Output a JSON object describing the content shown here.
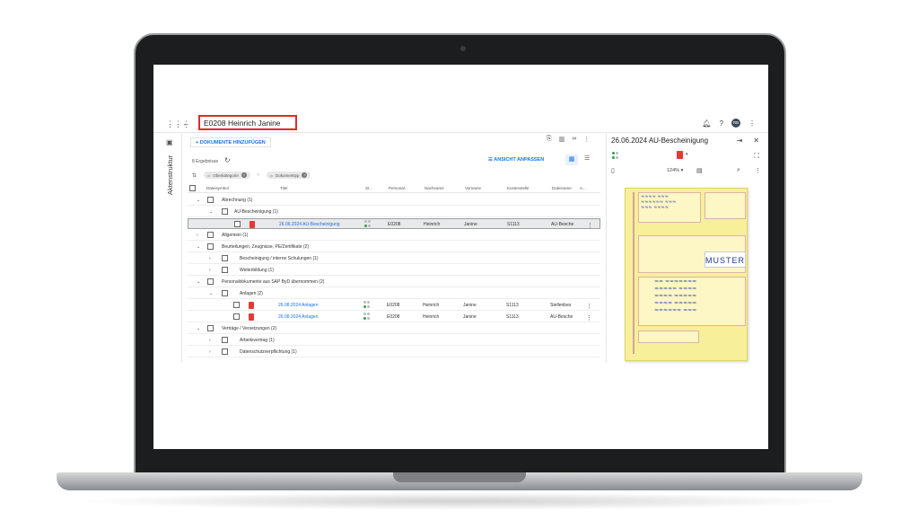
{
  "header": {
    "title": "E0208 Heinrich Janine",
    "avatar_initials": "RB"
  },
  "sidebar": {
    "label": "Aktenstruktur"
  },
  "toolbar": {
    "add_documents": "+ DOKUMENTE HINZUFÜGEN",
    "results": "8 Ergebnisse",
    "adjust_view": "ANSICHT ANPASSEN"
  },
  "filters": [
    {
      "label": "Oberkategorie"
    },
    {
      "label": "Dokumenttyp"
    }
  ],
  "table": {
    "headers": [
      "Dateisymbol",
      "Titel",
      "St...",
      "Personal...",
      "Nachname",
      "Vorname",
      "Kostenstelle",
      "Dateiname",
      "A..."
    ],
    "rows": [
      {
        "label": "Abrechnung (1)"
      },
      {
        "label": "AU-Bescheinigung (1)"
      },
      {
        "title": "26.06.2024 AU-Bescheinigung",
        "personal": "E0208",
        "nachname": "Heinrich",
        "vorname": "Janine",
        "kostenstelle": "S1113",
        "dateiname": "AU-Besche"
      },
      {
        "label": "Allgemein (1)"
      },
      {
        "label": "Beurteilungen, Zeugnisse, PE/Zertifikate (2)"
      },
      {
        "label": "Bescheinigung / interne Schulungen (1)"
      },
      {
        "label": "Weiterbildung (1)"
      },
      {
        "label": "Personaldokumente aus SAP ByD übernommen (2)"
      },
      {
        "label": "Anlagen (2)"
      },
      {
        "title": "26.08.2024 Anlagen",
        "personal": "E0208",
        "nachname": "Heinrich",
        "vorname": "Janine",
        "kostenstelle": "S1113",
        "dateiname": "Stellenbes"
      },
      {
        "title": "26.08.2024 Anlagen",
        "personal": "E0208",
        "nachname": "Heinrich",
        "vorname": "Janine",
        "kostenstelle": "S1113",
        "dateiname": "AU-Besche"
      },
      {
        "label": "Verträge / Versetzungen (2)"
      },
      {
        "label": "Arbeitsvertrag (1)"
      },
      {
        "label": "Datenschutzverpflichtung (1)"
      }
    ]
  },
  "preview": {
    "title": "26.06.2024 AU-Bescheinigung",
    "zoom": "124%",
    "doc_stamp": "MUSTER"
  },
  "colors": {
    "accent": "#1a73e8",
    "highlight_border": "#d93025",
    "pdf_red": "#e53935",
    "document_yellow": "#f7ef9a"
  }
}
